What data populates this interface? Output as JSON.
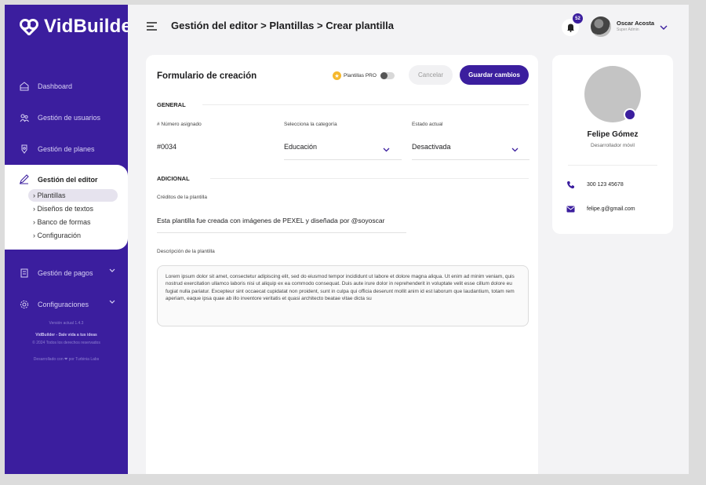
{
  "app": {
    "logo_text": "VidBuilder"
  },
  "header": {
    "title": "Gestión del editor > Plantillas > Crear plantilla",
    "notifications_count": "52",
    "user_name": "Oscar Acosta",
    "user_role": "Super Admin"
  },
  "sidebar": {
    "items": [
      {
        "label": "Dashboard",
        "icon": "dashboard-icon"
      },
      {
        "label": "Gestión de usuarios",
        "icon": "users-icon"
      },
      {
        "label": "Gestión de planes",
        "icon": "plans-icon"
      }
    ],
    "active": {
      "label": "Gestión del editor",
      "icon": "editor-icon",
      "subitems": [
        "Plantillas",
        "Diseños de textos",
        "Banco de formas",
        "Configuración"
      ],
      "selected_index": 0
    },
    "items_after": [
      {
        "label": "Gestión de pagos",
        "icon": "payments-icon"
      },
      {
        "label": "Configuraciones",
        "icon": "settings-icon"
      }
    ],
    "footer": {
      "version": "Versión actual 1.4.3",
      "tagline": "VidBuilder - Dale vida a tus ideas",
      "copyright": "© 2024 Todos los derechos reservados",
      "credit": "Desarrollado con ❤ por Turbinia Labs"
    }
  },
  "form": {
    "title": "Formulario de creación",
    "pro_label": "Plantillas PRO",
    "pro_enabled": false,
    "cancel_label": "Cancelar",
    "save_label": "Guardar cambios",
    "general_section": "GENERAL",
    "number_label": "# Número asignado",
    "number_value": "#0034",
    "category_label": "Selecciona la categoría",
    "category_value": "Educación",
    "status_label": "Estado actual",
    "status_value": "Desactivada",
    "additional_section": "ADICIONAL",
    "credits_label": "Créditos de la plantilla",
    "credits_value": "Esta plantilla fue creada con imágenes de PEXEL y diseñada por @soyoscar",
    "description_label": "Descripción de la plantilla",
    "description_value": "Lorem ipsum dolor sit amet, consectetur adipiscing elit, sed do eiusmod tempor incididunt ut labore et dolore magna aliqua. Ut enim ad minim veniam, quis nostrud exercitation ullamco laboris nisi ut aliquip ex ea commodo consequat. Duis aute irure dolor in reprehenderit in voluptate velit esse cillum dolore eu fugiat nulla pariatur. Excepteur sint occaecat cupidatat non proident, sunt in culpa qui officia deserunt mollit anim id est laborum que laudantium, totam rem aperiam, eaque ipsa quae ab illo inventore veritatis et quasi architecto beatae vitae dicta su"
  },
  "profile": {
    "name": "Felipe Gómez",
    "role": "Desarrollador móvil",
    "phone": "300 123 45678",
    "email": "felipe.g@gmail.com"
  },
  "colors": {
    "primary": "#3b1e9e",
    "star": "#f5b82e"
  }
}
